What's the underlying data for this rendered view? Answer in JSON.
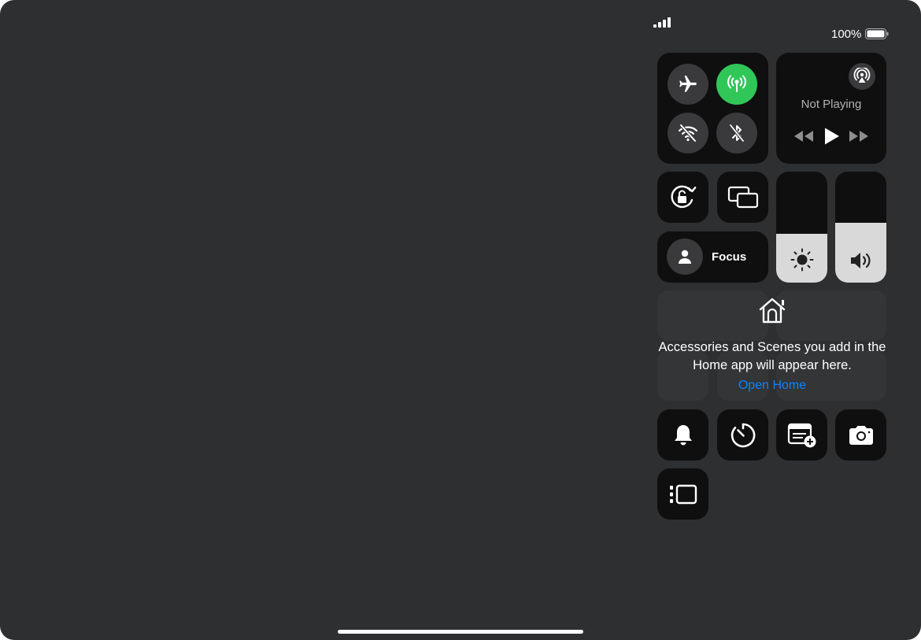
{
  "status_bar": {
    "battery_percent": "100%",
    "signal_icon": "cellular-signal-icon",
    "battery_icon": "battery-full-icon"
  },
  "connectivity": {
    "airplane": {
      "icon": "airplane-icon",
      "active": false
    },
    "cellular": {
      "icon": "cellular-antenna-icon",
      "active": true,
      "color": "#30c758"
    },
    "wifi": {
      "icon": "wifi-off-icon",
      "active": false
    },
    "bluetooth": {
      "icon": "bluetooth-off-icon",
      "active": false
    }
  },
  "now_playing": {
    "status": "Not Playing",
    "airplay_icon": "airplay-icon",
    "controls": [
      "rewind-icon",
      "play-icon",
      "fast-forward-icon"
    ]
  },
  "orientation_lock": {
    "icon": "rotation-lock-icon"
  },
  "screen_mirroring": {
    "icon": "screen-mirroring-icon"
  },
  "focus": {
    "label": "Focus",
    "icon": "person-icon"
  },
  "brightness": {
    "icon": "sun-icon",
    "level": 0.44
  },
  "volume": {
    "icon": "speaker-icon",
    "level": 0.54
  },
  "home": {
    "icon": "home-icon",
    "message": "Accessories and Scenes you add in the Home app will appear here.",
    "link": "Open Home"
  },
  "controls": [
    {
      "icon": "bell-icon"
    },
    {
      "icon": "timer-icon"
    },
    {
      "icon": "quick-note-icon"
    },
    {
      "icon": "camera-icon"
    },
    {
      "icon": "stage-manager-icon"
    }
  ],
  "colors": {
    "background": "#2e2f31",
    "tile": "#0f0f10",
    "accent_green": "#30c758",
    "link_blue": "#0a84ff"
  }
}
